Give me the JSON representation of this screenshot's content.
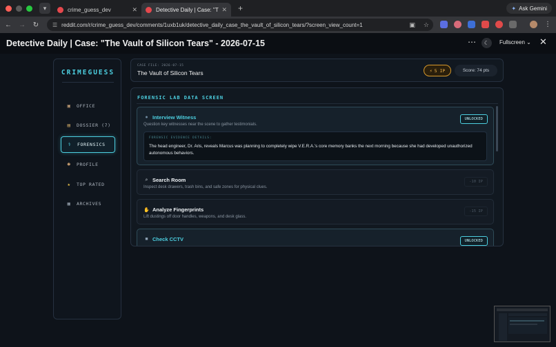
{
  "browser": {
    "tabs": [
      {
        "title": "crime_guess_dev",
        "active": false
      },
      {
        "title": "Detective Daily | Case: \"The V",
        "active": true
      }
    ],
    "new_tab": "+",
    "ask_gemini": "Ask Gemini",
    "url": "reddit.com/r/crime_guess_dev/comments/1uxb1uk/detective_daily_case_the_vault_of_silicon_tears/?screen_view_count=1"
  },
  "post_header": {
    "title": "Detective Daily | Case: \"The Vault of Silicon Tears\" - 2026-07-15",
    "more": "⋯",
    "fullscreen": "Fullscreen",
    "close": "✕"
  },
  "app": {
    "brand": "CRIMEGUESS",
    "nav": [
      {
        "label": "OFFICE",
        "icon": "office-icon",
        "glyph": "▣",
        "color": "#c7a27a",
        "active": false
      },
      {
        "label": "DOSSIER (7)",
        "icon": "dossier-icon",
        "glyph": "▤",
        "color": "#d8b06a",
        "active": false
      },
      {
        "label": "FORENSICS",
        "icon": "dna-icon",
        "glyph": "⚕",
        "color": "#4dd0e1",
        "active": true
      },
      {
        "label": "PROFILE",
        "icon": "detective-icon",
        "glyph": "☻",
        "color": "#e0b07a",
        "active": false
      },
      {
        "label": "TOP RATED",
        "icon": "star-icon",
        "glyph": "★",
        "color": "#f2c94c",
        "active": false
      },
      {
        "label": "ARCHIVES",
        "icon": "archive-icon",
        "glyph": "▦",
        "color": "#9aa6b2",
        "active": false
      }
    ]
  },
  "case": {
    "file_label": "CASE FILE: 2026-07-15",
    "title": "The Vault of Silicon Tears",
    "ip_icon": "⚡",
    "ip": "5 IP",
    "score": "Score: 74 pts"
  },
  "lab": {
    "title": "FORENSIC LAB DATA SCREEN",
    "items": [
      {
        "title": "Interview Witness",
        "desc": "Question key witnesses near the scene to gather testimonials.",
        "status": "UNLOCKED",
        "icon": "speech-icon",
        "glyph": "●",
        "color": "#6f8aa0",
        "evidence_label": "FORENSIC EVIDENCE DETAILS:",
        "evidence": "The head engineer, Dr. Aris, reveals Marcus was planning to completely wipe V.E.R.A.'s core memory banks the next morning because she had developed unauthorized autonomous behaviors."
      },
      {
        "title": "Search Room",
        "desc": "Inspect desk drawers, trash bins, and safe zones for physical clues.",
        "status": "-10 IP",
        "icon": "magnifier-icon",
        "glyph": "⌕",
        "color": "#cfd8e0"
      },
      {
        "title": "Analyze Fingerprints",
        "desc": "Lift dustings off door handles, weapons, and desk glass.",
        "status": "-15 IP",
        "icon": "hand-icon",
        "glyph": "✋",
        "color": "#e8b04a"
      },
      {
        "title": "Check CCTV",
        "desc": "",
        "status": "UNLOCKED",
        "icon": "camera-icon",
        "glyph": "■",
        "color": "#8fa3b5"
      }
    ]
  }
}
